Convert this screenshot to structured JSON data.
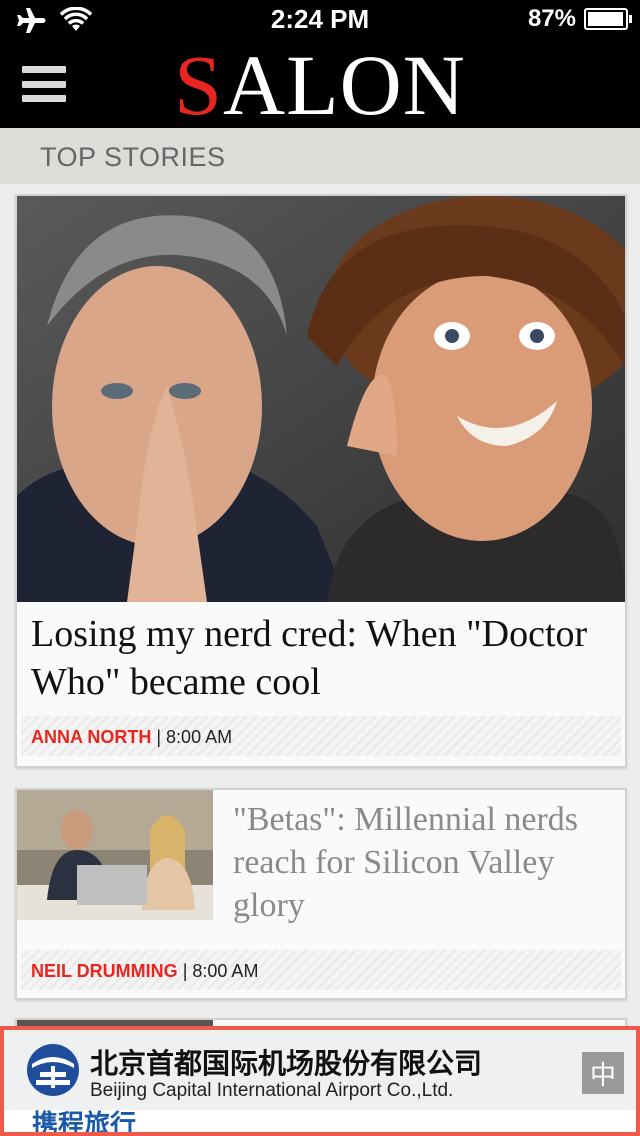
{
  "status_bar": {
    "time": "2:24 PM",
    "battery": "87%",
    "battery_level": 0.87,
    "icons": [
      "airplane-icon",
      "wifi-icon",
      "battery-icon"
    ]
  },
  "header": {
    "logo_first": "S",
    "logo_rest": "ALON",
    "brand_color": "#e8251f"
  },
  "section": {
    "title": "TOP STORIES"
  },
  "stories": [
    {
      "headline": "Losing my nerd cred: When \"Doctor Who\" became cool",
      "author": "ANNA NORTH",
      "separator": "|",
      "time": "8:00 AM"
    },
    {
      "headline": "\"Betas\": Millennial nerds reach for Silicon Valley glory",
      "author": "NEIL DRUMMING",
      "separator": "|",
      "time": "8:00 AM"
    }
  ],
  "ad": {
    "title_cn": "北京首都国际机场股份有限公司",
    "title_en": "Beijing Capital International Airport Co.,Ltd.",
    "lang_button": "中",
    "border_color": "#ef5a4a",
    "bottom_text": "携程旅行"
  }
}
